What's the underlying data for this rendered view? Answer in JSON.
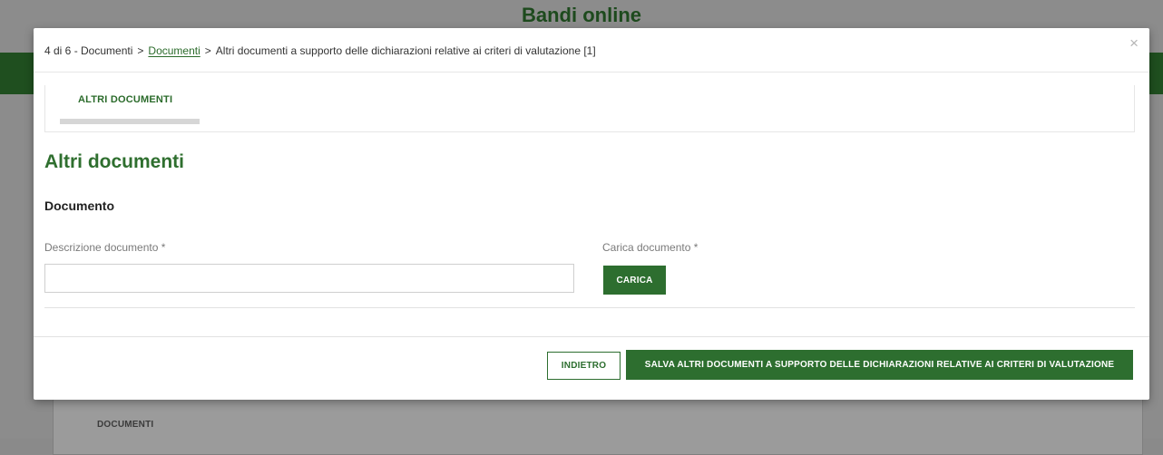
{
  "background": {
    "title": "Bandi online",
    "card_label": "DOCUMENTI"
  },
  "modal": {
    "breadcrumb": {
      "step": "4 di 6 - Documenti",
      "sep1": ">",
      "link": "Documenti",
      "sep2": ">",
      "current": "Altri documenti a supporto delle dichiarazioni relative ai criteri di valutazione [1]"
    },
    "close_glyph": "×",
    "tab_label": "ALTRI DOCUMENTI",
    "section_title": "Altri documenti",
    "sub_title": "Documento",
    "description_label": "Descrizione documento *",
    "description_value": "",
    "upload_label": "Carica documento *",
    "upload_button": "CARICA",
    "back_button": "INDIETRO",
    "save_button": "SALVA ALTRI DOCUMENTI A SUPPORTO DELLE DICHIARAZIONI RELATIVE AI CRITERI DI VALUTAZIONE"
  },
  "colors": {
    "accent_green": "#2d6e2f",
    "dark_green_bar": "#1f4f1f",
    "overlay_gray": "#8a8a8a"
  }
}
